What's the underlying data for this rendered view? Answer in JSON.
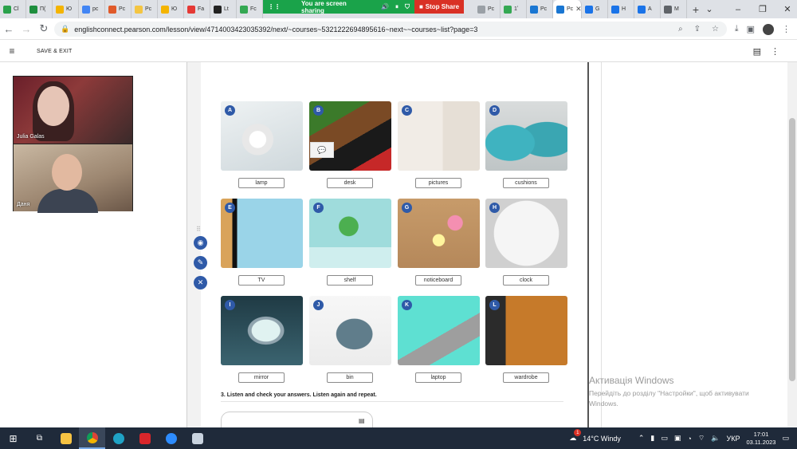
{
  "browser": {
    "tabs": [
      {
        "label": "Cl",
        "color": "#2aa14b"
      },
      {
        "label": "П(",
        "color": "#1e8e3e"
      },
      {
        "label": "Ю",
        "color": "#f4b400"
      },
      {
        "label": "pc",
        "color": "#4285f4"
      },
      {
        "label": "Pc",
        "color": "#e05a2a"
      },
      {
        "label": "Pc",
        "color": "#f4c542"
      },
      {
        "label": "Ю",
        "color": "#f4b400"
      },
      {
        "label": "Fa",
        "color": "#e53935"
      },
      {
        "label": "Lt",
        "color": "#222222"
      },
      {
        "label": "Fc",
        "color": "#34a853"
      }
    ],
    "tabs_right": [
      {
        "label": "Pc",
        "color": "#9aa0a6"
      },
      {
        "label": "1ʼ",
        "color": "#34a853"
      },
      {
        "label": "Pc",
        "color": "#1976d2"
      },
      {
        "label": "Pc",
        "color": "#1976d2",
        "active": true
      },
      {
        "label": "G",
        "color": "#1a73e8"
      },
      {
        "label": "H",
        "color": "#1a73e8"
      },
      {
        "label": "A",
        "color": "#1a73e8"
      },
      {
        "label": "M",
        "color": "#5f6368"
      }
    ],
    "screen_share_text": "You are screen sharing",
    "stop_share_label": "Stop Share",
    "url": "englishconnect.pearson.com/lesson/view/4714003423035392/next/~courses~5321222694895616~next~~courses~list?page=3"
  },
  "app": {
    "save_exit_label": "SAVE & EXIT"
  },
  "video": {
    "participant1": "Julia Galas",
    "participant2": "Даня"
  },
  "exercise": {
    "items": [
      {
        "letter": "A",
        "label": "lamp"
      },
      {
        "letter": "B",
        "label": "desk"
      },
      {
        "letter": "C",
        "label": "pictures"
      },
      {
        "letter": "D",
        "label": "cushions"
      },
      {
        "letter": "E",
        "label": "TV"
      },
      {
        "letter": "F",
        "label": "shelf"
      },
      {
        "letter": "G",
        "label": "noticeboard"
      },
      {
        "letter": "H",
        "label": "clock"
      },
      {
        "letter": "I",
        "label": "mirror"
      },
      {
        "letter": "J",
        "label": "bin"
      },
      {
        "letter": "K",
        "label": "laptop"
      },
      {
        "letter": "L",
        "label": "wardrobe"
      }
    ],
    "next_instruction": "3. Listen and check your answers. Listen again and repeat."
  },
  "watermark": {
    "title": "Активація Windows",
    "subtitle": "Перейдіть до розділу \"Настройки\", щоб активувати Windows."
  },
  "taskbar": {
    "weather": "14°C  Windy",
    "language": "УКР",
    "time": "17:01",
    "date": "03.11.2023",
    "notification_count": "1"
  }
}
